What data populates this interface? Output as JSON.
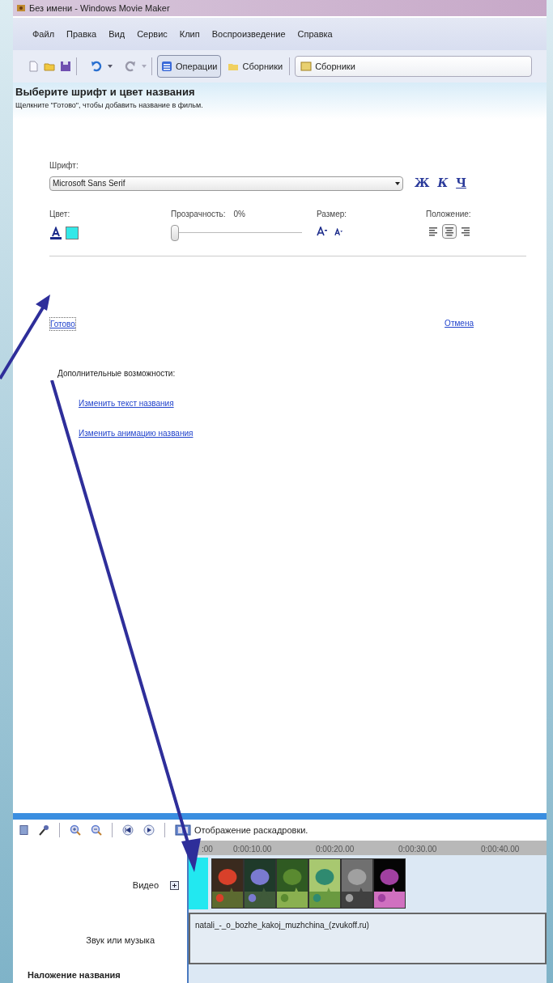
{
  "window": {
    "title": "Без имени - Windows Movie Maker"
  },
  "menu": [
    "Файл",
    "Правка",
    "Вид",
    "Сервис",
    "Клип",
    "Воспроизведение",
    "Справка"
  ],
  "toolbar": {
    "tasks_button": {
      "label": "Операции",
      "selected": true
    },
    "collections_button": {
      "label": "Сборники",
      "selected": false
    },
    "collections_field": "Сборники"
  },
  "task": {
    "title": "Выберите шрифт и цвет названия",
    "subtitle": "Щелкните \"Готово\", чтобы добавить название в фильм.",
    "font": {
      "label": "Шрифт:",
      "value": "Microsoft Sans Serif"
    },
    "style_buttons": [
      "Ж",
      "К",
      "Ч"
    ],
    "color": {
      "label": "Цвет:"
    },
    "transparency": {
      "label": "Прозрачность:",
      "reading": "0%",
      "level": 0
    },
    "size": {
      "label": "Размер:"
    },
    "position": {
      "label": "Положение:",
      "alignments": [
        {
          "kind": "left",
          "selected": false
        },
        {
          "kind": "center",
          "selected": true
        },
        {
          "kind": "right",
          "selected": false
        }
      ]
    },
    "done_link": "Готово",
    "cancel_link": "Отмена",
    "more_label": "Дополнительные возможности:",
    "more_links": [
      "Изменить текст названия",
      "Изменить анимацию названия"
    ]
  },
  "timeline": {
    "view_label": "Отображение раскадровки.",
    "ruler": [
      ":00",
      "0:00:10.00",
      "0:00:20.00",
      "0:00:30.00",
      "0:00:40.00"
    ],
    "tracks": [
      {
        "kind": "video",
        "label": "Видео",
        "expanded": false
      },
      {
        "kind": "audio",
        "label": "Звук или музыка",
        "clip": "natali_-_o_bozhe_kakoj_muzhchina_(zvukoff.ru)"
      },
      {
        "kind": "title",
        "label": "Наложение названия"
      }
    ],
    "video_clips": [
      {
        "kind": "title"
      },
      {
        "kind": "picture"
      },
      {
        "kind": "picture"
      },
      {
        "kind": "picture"
      },
      {
        "kind": "picture"
      },
      {
        "kind": "picture"
      },
      {
        "kind": "picture"
      }
    ]
  }
}
